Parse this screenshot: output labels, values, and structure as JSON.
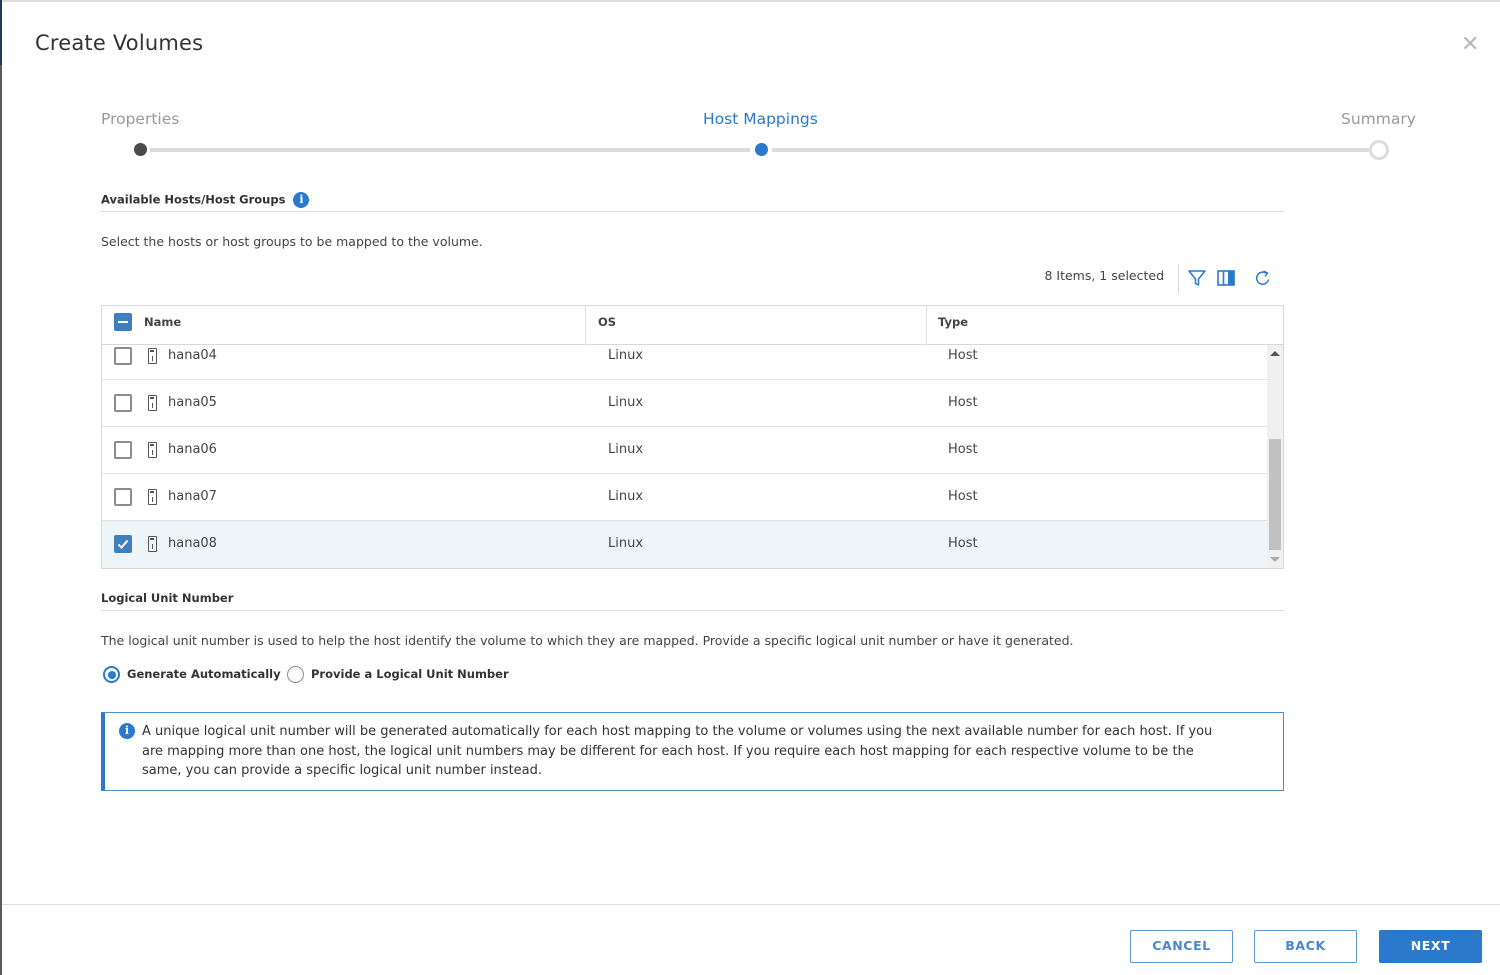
{
  "dialog": {
    "title": "Create Volumes",
    "close_icon": "close-icon"
  },
  "stepper": {
    "steps": [
      {
        "label": "Properties",
        "state": "completed"
      },
      {
        "label": "Host Mappings",
        "state": "active"
      },
      {
        "label": "Summary",
        "state": "pending"
      }
    ]
  },
  "hosts_section": {
    "title": "Available Hosts/Host Groups",
    "info_icon": "i",
    "description": "Select the hosts or host groups to be mapped to the volume.",
    "count_text": "8 Items, 1 selected",
    "toolbar_icons": [
      "filter-icon",
      "columns-icon",
      "refresh-icon"
    ],
    "columns": [
      "Name",
      "OS",
      "Type"
    ],
    "rows": [
      {
        "name": "hana04",
        "os": "Linux",
        "type": "Host",
        "checked": false
      },
      {
        "name": "hana05",
        "os": "Linux",
        "type": "Host",
        "checked": false
      },
      {
        "name": "hana06",
        "os": "Linux",
        "type": "Host",
        "checked": false
      },
      {
        "name": "hana07",
        "os": "Linux",
        "type": "Host",
        "checked": false
      },
      {
        "name": "hana08",
        "os": "Linux",
        "type": "Host",
        "checked": true
      }
    ],
    "select_all_state": "indeterminate"
  },
  "lun_section": {
    "title": "Logical Unit Number",
    "description": "The logical unit number is used to help the host identify the volume to which they are mapped. Provide a specific logical unit number or have it generated.",
    "options": [
      {
        "label": "Generate Automatically",
        "selected": true
      },
      {
        "label": "Provide a Logical Unit Number",
        "selected": false
      }
    ],
    "alert_icon": "i",
    "alert_text": "A unique logical unit number will be generated automatically for each host mapping to the volume or volumes using the next available number for each host. If you are mapping more than one host, the logical unit numbers may be different for each host. If you require each host mapping for each respective volume to be the same, you can provide a specific logical unit number instead."
  },
  "footer": {
    "cancel_label": "CANCEL",
    "back_label": "BACK",
    "next_label": "NEXT"
  },
  "colors": {
    "accent": "#2a79cc",
    "checkbox_checked": "#3e7fbd",
    "selected_row": "#eef5f9",
    "step_done": "#4a4a4a"
  }
}
